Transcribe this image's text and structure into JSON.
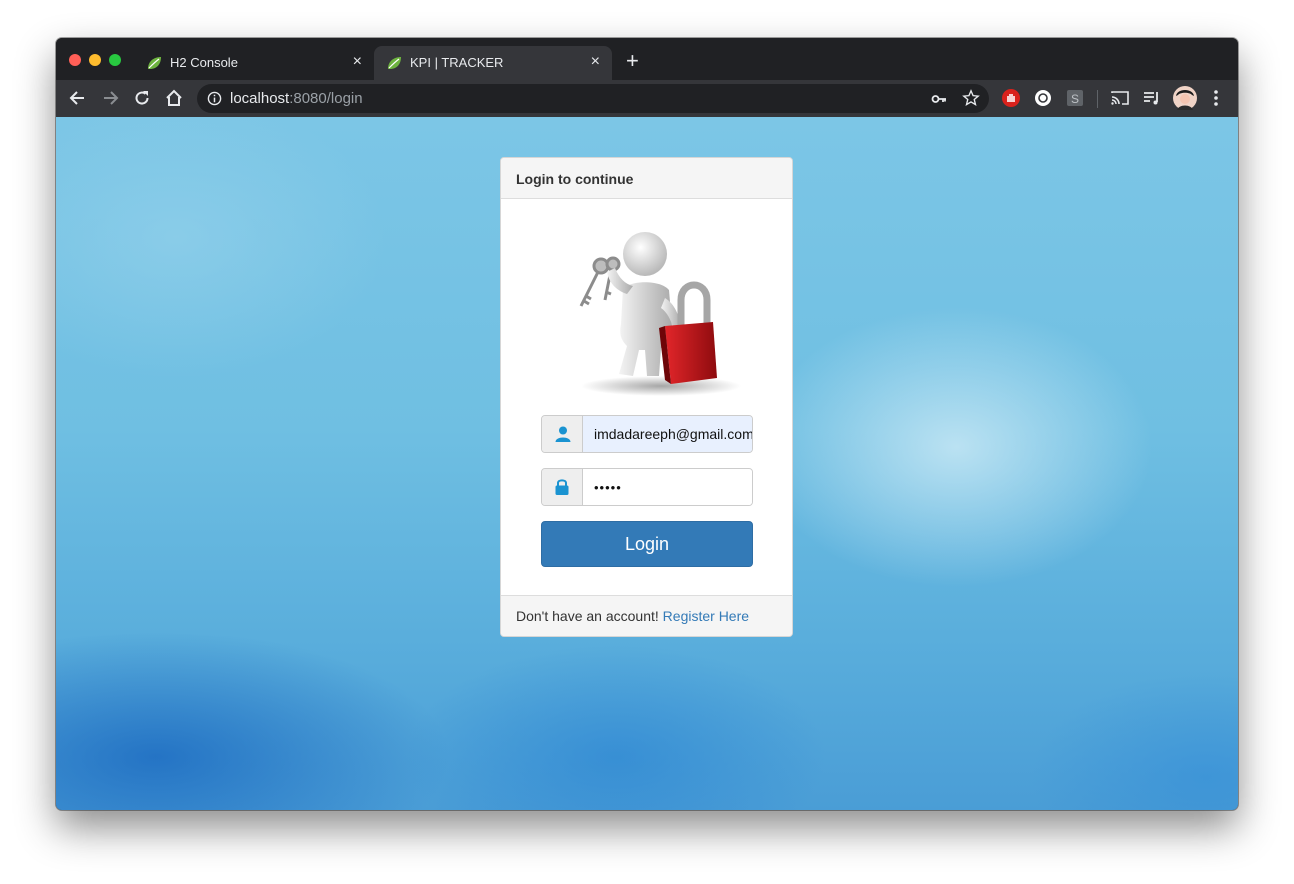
{
  "browser": {
    "tabs": [
      {
        "title": "H2 Console",
        "active": false
      },
      {
        "title": "KPI | TRACKER",
        "active": true
      }
    ],
    "new_tab_label": "+",
    "close_label": "×",
    "url_host": "localhost",
    "url_rest": ":8080/login",
    "toolbar_icons": [
      "back-icon",
      "forward-icon",
      "reload-icon",
      "home-icon",
      "key-icon",
      "star-icon",
      "stop-extension-icon",
      "extension-icon",
      "s-extension-icon",
      "cast-icon",
      "media-queue-icon",
      "avatar",
      "menu-icon"
    ]
  },
  "login": {
    "heading": "Login to continue",
    "username_value": "imdadareeph@gmail.com",
    "password_masked": "•••••",
    "button_label": "Login",
    "footer_text": "Don't have an account! ",
    "register_link": "Register Here"
  },
  "colors": {
    "primary": "#337ab7",
    "addon_icon": "#1a93d1",
    "lock_red": "#c81418"
  }
}
